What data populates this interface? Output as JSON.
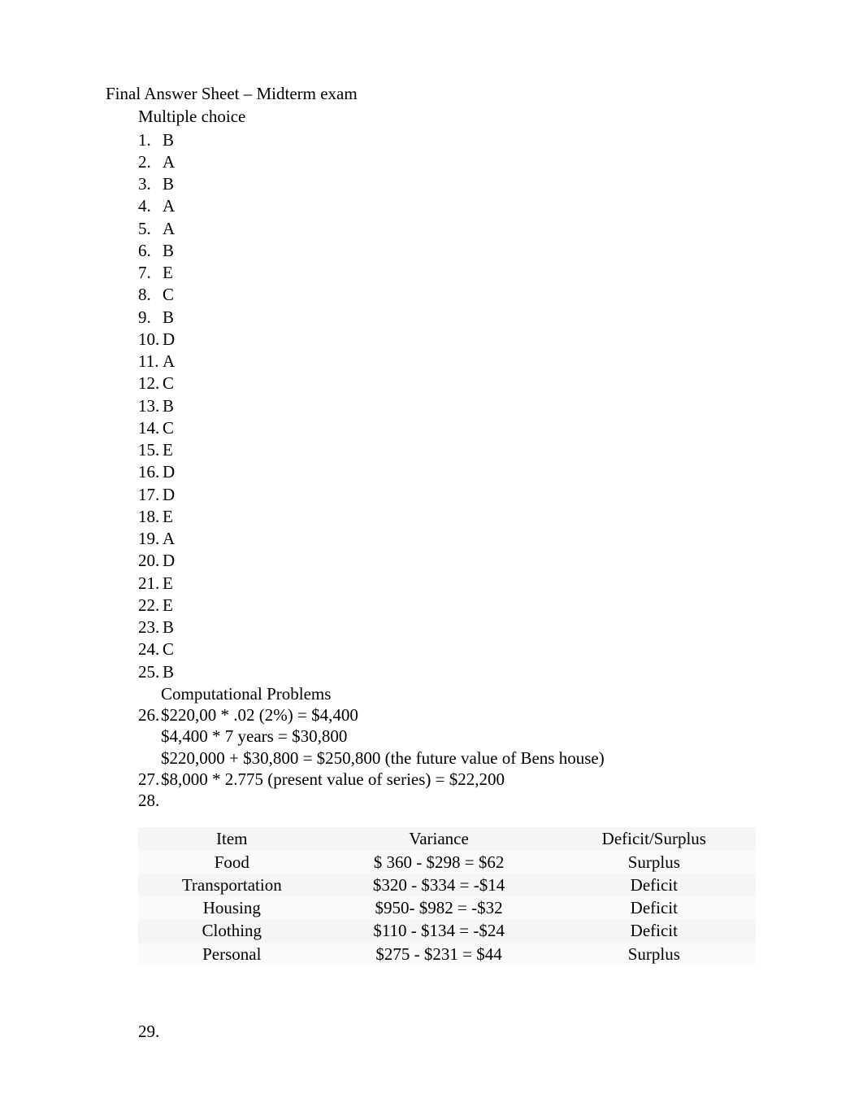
{
  "title": "Final Answer Sheet – Midterm exam",
  "mc_label": "Multiple choice",
  "mc": [
    {
      "n": "1.",
      "a": "B"
    },
    {
      "n": "2.",
      "a": "A"
    },
    {
      "n": "3.",
      "a": "B"
    },
    {
      "n": "4.",
      "a": "A"
    },
    {
      "n": "5.",
      "a": "A"
    },
    {
      "n": "6.",
      "a": "B"
    },
    {
      "n": "7.",
      "a": "E"
    },
    {
      "n": "8.",
      "a": "C"
    },
    {
      "n": "9.",
      "a": "B"
    },
    {
      "n": "10.",
      "a": "D"
    },
    {
      "n": "11.",
      "a": "A"
    },
    {
      "n": "12.",
      "a": "C"
    },
    {
      "n": "13.",
      "a": "B"
    },
    {
      "n": "14.",
      "a": "C"
    },
    {
      "n": "15.",
      "a": "E"
    },
    {
      "n": "16.",
      "a": "D"
    },
    {
      "n": "17.",
      "a": "D"
    },
    {
      "n": "18.",
      "a": "E"
    },
    {
      "n": "19.",
      "a": "A"
    },
    {
      "n": "20.",
      "a": "D"
    },
    {
      "n": "21.",
      "a": "E"
    },
    {
      "n": "22.",
      "a": "E"
    },
    {
      "n": "23.",
      "a": "B"
    },
    {
      "n": "24.",
      "a": "C"
    },
    {
      "n": "25.",
      "a": "B"
    }
  ],
  "comp_label": "Computational Problems",
  "q26": {
    "n": "26.",
    "line1": "$220,00 * .02 (2%) = $4,400",
    "line2": "$4,400 * 7 years = $30,800",
    "line3": "$220,000 + $30,800 = $250,800 (the future value of Bens house)"
  },
  "q27": {
    "n": "27.",
    "line1": "$8,000 * 2.775 (present value of series) =  $22,200"
  },
  "q28": {
    "n": "28."
  },
  "table": {
    "headers": [
      "Item",
      "Variance",
      "Deficit/Surplus"
    ],
    "rows": [
      {
        "item": "Food",
        "variance": "$ 360 - $298 = $62",
        "ds": "Surplus"
      },
      {
        "item": "Transportation",
        "variance": "$320 - $334 = -$14",
        "ds": "Deficit"
      },
      {
        "item": "Housing",
        "variance": "$950- $982 = -$32",
        "ds": "Deficit"
      },
      {
        "item": "Clothing",
        "variance": "$110  - $134 = -$24",
        "ds": "Deficit"
      },
      {
        "item": "Personal",
        "variance": "$275 - $231 = $44",
        "ds": "Surplus"
      }
    ]
  },
  "q29": {
    "n": "29."
  }
}
